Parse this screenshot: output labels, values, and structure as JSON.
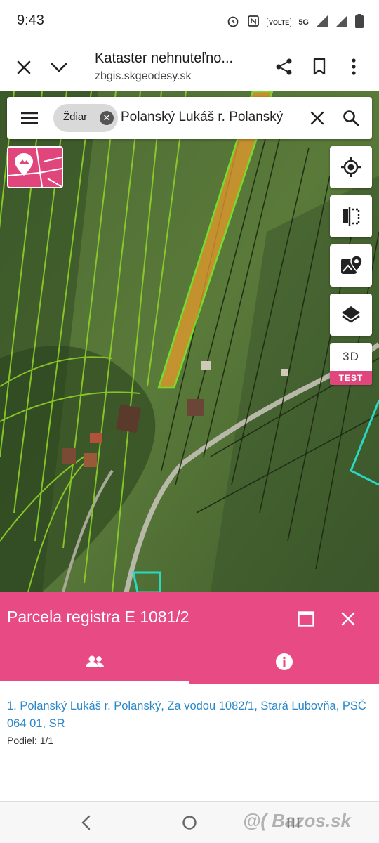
{
  "status": {
    "time": "9:43",
    "network_label": "5G",
    "volte_label": "VOLTE"
  },
  "browser": {
    "title": "Kataster nehnuteľno...",
    "url": "zbgis.skgeodesy.sk"
  },
  "search": {
    "chip_label": "Ždiar",
    "query": "Polanský Lukáš r. Polanský"
  },
  "map_controls": {
    "btn_3d_label": "3D",
    "btn_3d_badge": "TEST"
  },
  "parcel_panel": {
    "title": "Parcela registra E 1081/2",
    "owner": "1. Polanský Lukáš r. Polanský, Za vodou 1082/1, Stará Lubovňa, PSČ 064 01, SR",
    "share": "Podiel: 1/1"
  },
  "watermark": "@( Bazos.sk",
  "colors": {
    "accent": "#e84a84",
    "link": "#2a88c8",
    "parcel_highlight": "#e89a2c",
    "parcel_border": "#7dff2a",
    "neighbour_parcel": "#2ad9c4"
  },
  "icons": {
    "close": "close-icon",
    "collapse": "chevron-down-icon",
    "share": "share-icon",
    "bookmark": "bookmark-icon",
    "menu": "more-vert-icon",
    "hamburger": "hamburger-icon",
    "search": "search-icon",
    "locate": "my-location-icon",
    "compare": "compare-icon",
    "maps": "google-maps-icon",
    "layers": "layers-icon",
    "people": "people-icon",
    "info": "info-icon"
  }
}
